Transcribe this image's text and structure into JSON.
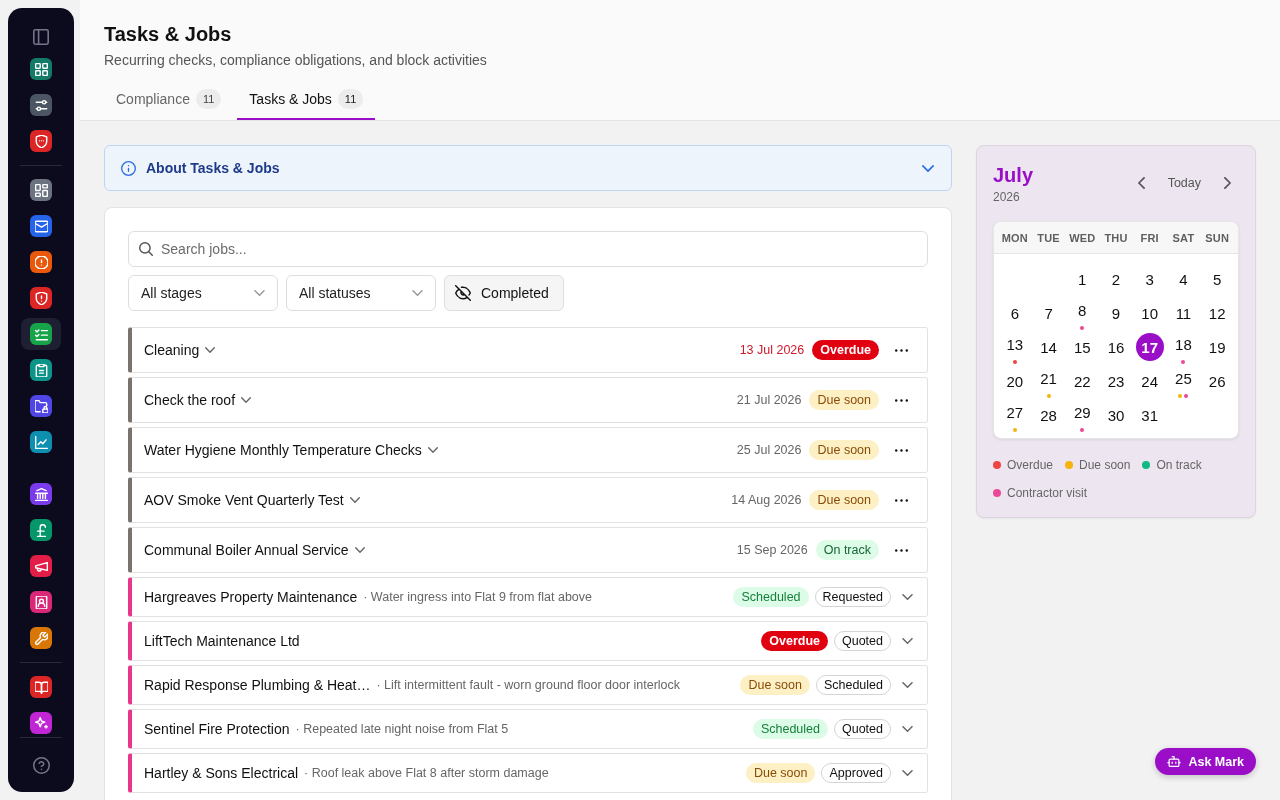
{
  "sidebar": {
    "groups": [
      {
        "divider_above": false,
        "items": [
          {
            "kind": "grid",
            "color": "#127a67",
            "selected": false
          },
          {
            "kind": "sliders",
            "color": "#4b5563",
            "selected": false
          },
          {
            "kind": "shield",
            "color": "#dc2626",
            "selected": false
          }
        ]
      },
      {
        "divider_above": true,
        "items": [
          {
            "kind": "dashboard",
            "color": "#6b7280",
            "selected": false
          },
          {
            "kind": "mail",
            "color": "#2563eb",
            "selected": false
          },
          {
            "kind": "alert",
            "color": "#ea580c",
            "selected": false
          },
          {
            "kind": "guard",
            "color": "#dc2626",
            "selected": false
          },
          {
            "kind": "checklist",
            "color": "#16a34a",
            "selected": true
          },
          {
            "kind": "clipboard",
            "color": "#0d9488",
            "selected": false
          },
          {
            "kind": "folder",
            "color": "#4f46e5",
            "selected": false
          },
          {
            "kind": "chart",
            "color": "#0e8fb0",
            "selected": false
          }
        ]
      },
      {
        "divider_above": false,
        "items": [
          {
            "kind": "bank",
            "color": "#7c3aed",
            "selected": false
          },
          {
            "kind": "pound",
            "color": "#059669",
            "selected": false
          },
          {
            "kind": "megaphone",
            "color": "#e11d48",
            "selected": false
          },
          {
            "kind": "contacts",
            "color": "#db2777",
            "selected": false
          },
          {
            "kind": "wrench",
            "color": "#d97706",
            "selected": false
          }
        ]
      },
      {
        "divider_above": true,
        "items": [
          {
            "kind": "book",
            "color": "#dc2626",
            "selected": false
          },
          {
            "kind": "sparkles",
            "color": "#c026d3",
            "selected": false
          }
        ]
      }
    ]
  },
  "header": {
    "title": "Tasks & Jobs",
    "subtitle": "Recurring checks, compliance obligations, and block activities"
  },
  "tabs": [
    {
      "label": "Compliance",
      "count": "11",
      "selected": false
    },
    {
      "label": "Tasks & Jobs",
      "count": "11",
      "selected": true
    }
  ],
  "about": {
    "title": "About Tasks & Jobs",
    "expanded": false
  },
  "search": {
    "placeholder": "Search jobs..."
  },
  "filters": [
    {
      "kind": "select",
      "label": "All stages"
    },
    {
      "kind": "select",
      "label": "All statuses"
    },
    {
      "kind": "toggle",
      "label": "Completed",
      "on": false
    }
  ],
  "jobs": [
    {
      "kind": "task",
      "name": "Cleaning",
      "date": "13 Jul 2026",
      "status": {
        "label": "Overdue",
        "kind": "overdue"
      }
    },
    {
      "kind": "task",
      "name": "Check the roof",
      "date": "21 Jul 2026",
      "status": {
        "label": "Due soon",
        "kind": "due"
      }
    },
    {
      "kind": "task",
      "name": "Water Hygiene Monthly Temperature Checks",
      "date": "25 Jul 2026",
      "status": {
        "label": "Due soon",
        "kind": "due"
      }
    },
    {
      "kind": "task",
      "name": "AOV Smoke Vent Quarterly Test",
      "date": "14 Aug 2026",
      "status": {
        "label": "Due soon",
        "kind": "due"
      }
    },
    {
      "kind": "task",
      "name": "Communal Boiler Annual Service",
      "date": "15 Sep 2026",
      "status": {
        "label": "On track",
        "kind": "ontrack"
      }
    },
    {
      "kind": "contractor",
      "name": "Hargreaves Property Maintenance",
      "note": "· Water ingress into Flat 9 from flat above",
      "status": {
        "label": "Scheduled",
        "kind": "scheduled"
      },
      "stage": "Requested"
    },
    {
      "kind": "contractor",
      "name": "LiftTech Maintenance Ltd",
      "status": {
        "label": "Overdue",
        "kind": "overdue"
      },
      "stage": "Quoted"
    },
    {
      "kind": "contractor",
      "name": "Rapid Response Plumbing & Heat…",
      "note": "· Lift intermittent fault - worn ground floor door interlock",
      "status": {
        "label": "Due soon",
        "kind": "due"
      },
      "stage": "Scheduled"
    },
    {
      "kind": "contractor",
      "name": "Sentinel Fire Protection",
      "note": "· Repeated late night noise from Flat 5",
      "status": {
        "label": "Scheduled",
        "kind": "scheduled"
      },
      "stage": "Quoted"
    },
    {
      "kind": "contractor",
      "name": "Hartley & Sons Electrical",
      "note": "· Roof leak above Flat 8 after storm damage",
      "status": {
        "label": "Due soon",
        "kind": "due"
      },
      "stage": "Approved"
    }
  ],
  "calendar": {
    "month": "July",
    "year": "2026",
    "today": "Today",
    "weekdays": [
      "MON",
      "TUE",
      "WED",
      "THU",
      "FRI",
      "SAT",
      "SUN"
    ],
    "weeks": [
      {
        "right_aligned": true,
        "days": [
          {
            "day": "1",
            "selected": false
          },
          {
            "day": "2",
            "selected": false
          },
          {
            "day": "3",
            "selected": false
          },
          {
            "day": "4",
            "selected": false
          },
          {
            "day": "5",
            "selected": false
          }
        ]
      },
      {
        "days": [
          {
            "day": "6",
            "selected": false
          },
          {
            "day": "7",
            "selected": false
          },
          {
            "day": "8",
            "selected": false,
            "dots": [
              {
                "color": "#ec4899"
              }
            ]
          },
          {
            "day": "9",
            "selected": false
          },
          {
            "day": "10",
            "selected": false
          },
          {
            "day": "11",
            "selected": false
          },
          {
            "day": "12",
            "selected": false
          }
        ]
      },
      {
        "days": [
          {
            "day": "13",
            "selected": false,
            "dots": [
              {
                "color": "#ef4444"
              }
            ]
          },
          {
            "day": "14",
            "selected": false
          },
          {
            "day": "15",
            "selected": false
          },
          {
            "day": "16",
            "selected": false
          },
          {
            "day": "17",
            "selected": true
          },
          {
            "day": "18",
            "selected": false,
            "dots": [
              {
                "color": "#ec4899"
              }
            ]
          },
          {
            "day": "19",
            "selected": false
          }
        ]
      },
      {
        "days": [
          {
            "day": "20",
            "selected": false
          },
          {
            "day": "21",
            "selected": false,
            "dots": [
              {
                "color": "#f5b30b"
              }
            ]
          },
          {
            "day": "22",
            "selected": false
          },
          {
            "day": "23",
            "selected": false
          },
          {
            "day": "24",
            "selected": false
          },
          {
            "day": "25",
            "selected": false,
            "dots": [
              {
                "color": "#f5b30b"
              },
              {
                "color": "#ec4899"
              }
            ]
          },
          {
            "day": "26",
            "selected": false
          }
        ]
      },
      {
        "right_aligned": false,
        "days": [
          {
            "day": "27",
            "selected": false,
            "dots": [
              {
                "color": "#f5b30b"
              }
            ]
          },
          {
            "day": "28",
            "selected": false
          },
          {
            "day": "29",
            "selected": false,
            "dots": [
              {
                "color": "#ec4899"
              }
            ]
          },
          {
            "day": "30",
            "selected": false
          },
          {
            "day": "31",
            "selected": false
          }
        ]
      }
    ],
    "legend": [
      {
        "label": "Overdue",
        "color": "#ef4444"
      },
      {
        "label": "Due soon",
        "color": "#f5b30b"
      },
      {
        "label": "On track",
        "color": "#10b981"
      },
      {
        "label": "Contractor visit",
        "color": "#ec4899"
      }
    ]
  },
  "assistant": {
    "label": "Ask Mark"
  }
}
